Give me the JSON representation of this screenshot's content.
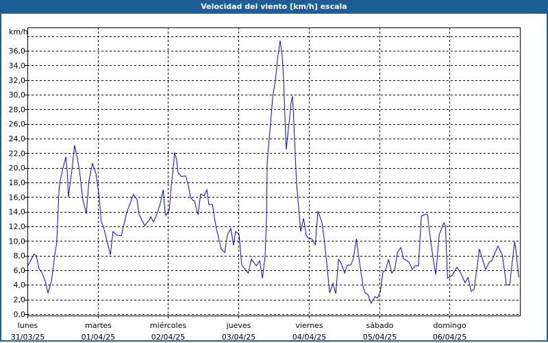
{
  "window": {
    "title": "Velocidad del viento [km/h] escala"
  },
  "chart_data": {
    "type": "line",
    "title": "Velocidad del viento [km/h] escala",
    "ylabel": "km/h",
    "xlabel": "",
    "ylim": [
      -0.2,
      39.2
    ],
    "xlim": [
      0,
      168
    ],
    "grid": true,
    "y_gridlines": [
      0,
      2,
      4,
      6,
      8,
      10,
      12,
      14,
      16,
      18,
      20,
      22,
      24,
      26,
      28,
      30,
      32,
      34,
      36,
      38
    ],
    "y_ticks": [
      "0,0",
      "2,0",
      "4,0",
      "6,0",
      "8,0",
      "10,0",
      "12,0",
      "14,0",
      "16,0",
      "18,0",
      "20,0",
      "22,0",
      "24,0",
      "26,0",
      "28,0",
      "30,0",
      "32,0",
      "34,0",
      "36,0"
    ],
    "x_ticks": [
      {
        "hour": 0,
        "day": "lunes",
        "date": "31/03/25"
      },
      {
        "hour": 24,
        "day": "martes",
        "date": "01/04/25"
      },
      {
        "hour": 48,
        "day": "miércoles",
        "date": "02/04/25"
      },
      {
        "hour": 72,
        "day": "jueves",
        "date": "03/04/25"
      },
      {
        "hour": 96,
        "day": "viernes",
        "date": "04/04/25"
      },
      {
        "hour": 120,
        "day": "sábado",
        "date": "05/04/25"
      },
      {
        "hour": 144,
        "day": "domingo",
        "date": "06/04/25"
      }
    ],
    "series": [
      {
        "name": "Velocidad del viento",
        "color": "#0000ff",
        "points": [
          [
            0,
            6.5
          ],
          [
            2.3,
            8.2
          ],
          [
            3.0,
            8.0
          ],
          [
            4.0,
            6.2
          ],
          [
            4.9,
            5.7
          ],
          [
            6.1,
            4.5
          ],
          [
            7.0,
            2.9
          ],
          [
            8.2,
            4.5
          ],
          [
            9.3,
            8.0
          ],
          [
            10.0,
            9.8
          ],
          [
            10.8,
            17
          ],
          [
            11.2,
            18.3
          ],
          [
            12.4,
            20.4
          ],
          [
            13.1,
            21.5
          ],
          [
            13.6,
            19.5
          ],
          [
            14.0,
            16
          ],
          [
            14.5,
            17.6
          ],
          [
            15.2,
            19.8
          ],
          [
            16.1,
            23.1
          ],
          [
            17.1,
            21.1
          ],
          [
            17.8,
            19.5
          ],
          [
            18.9,
            15.7
          ],
          [
            20.1,
            13.7
          ],
          [
            21.0,
            18.3
          ],
          [
            22.2,
            20.6
          ],
          [
            23.4,
            19.2
          ],
          [
            24.5,
            16
          ],
          [
            25.2,
            12.6
          ],
          [
            25.9,
            12
          ],
          [
            27.1,
            10.1
          ],
          [
            28.3,
            8.1
          ],
          [
            29.2,
            11.3
          ],
          [
            30.4,
            10.8
          ],
          [
            32.0,
            10.7
          ],
          [
            33.9,
            13.9
          ],
          [
            36.2,
            16.4
          ],
          [
            37.4,
            15.6
          ],
          [
            38.1,
            13.6
          ],
          [
            40.0,
            12.1
          ],
          [
            41.6,
            12.9
          ],
          [
            42.1,
            13.3
          ],
          [
            43.0,
            12.6
          ],
          [
            44.4,
            13.9
          ],
          [
            45.3,
            15.1
          ],
          [
            46.3,
            17
          ],
          [
            47.0,
            13.9
          ],
          [
            47.2,
            13.5
          ],
          [
            48.4,
            14.2
          ],
          [
            49.1,
            17.6
          ],
          [
            49.8,
            20.1
          ],
          [
            50.2,
            22.1
          ],
          [
            50.9,
            21.1
          ],
          [
            51.4,
            19.3
          ],
          [
            52.6,
            18.8
          ],
          [
            54.0,
            18.9
          ],
          [
            54.9,
            17.6
          ],
          [
            55.6,
            16
          ],
          [
            56.6,
            15.5
          ],
          [
            57.0,
            15.5
          ],
          [
            57.7,
            14.3
          ],
          [
            58.2,
            13.6
          ],
          [
            59.1,
            16.4
          ],
          [
            60.3,
            16.2
          ],
          [
            61.2,
            17
          ],
          [
            61.9,
            15
          ],
          [
            63.1,
            15
          ],
          [
            64.3,
            12
          ],
          [
            66.1,
            8.9
          ],
          [
            67.3,
            8.4
          ],
          [
            68.2,
            10.8
          ],
          [
            69.4,
            11.7
          ],
          [
            70.3,
            9.4
          ],
          [
            71.0,
            11.3
          ],
          [
            72.2,
            10.9
          ],
          [
            73.1,
            6.7
          ],
          [
            75.3,
            5.6
          ],
          [
            76.4,
            7.5
          ],
          [
            78.1,
            6.6
          ],
          [
            79.2,
            7.3
          ],
          [
            80.2,
            4.9
          ],
          [
            81.1,
            8
          ],
          [
            81.6,
            13.6
          ],
          [
            81.8,
            20.7
          ],
          [
            82.3,
            23.2
          ],
          [
            83.0,
            26.3
          ],
          [
            83.7,
            29.8
          ],
          [
            84.6,
            32
          ],
          [
            85.3,
            34.8
          ],
          [
            86.2,
            37.4
          ],
          [
            86.9,
            35.4
          ],
          [
            87.4,
            32
          ],
          [
            87.9,
            26.3
          ],
          [
            88.3,
            22.5
          ],
          [
            88.8,
            24.5
          ],
          [
            89.3,
            26.3
          ],
          [
            90.0,
            29.1
          ],
          [
            90.4,
            29.8
          ],
          [
            90.7,
            27.9
          ],
          [
            91.4,
            21.4
          ],
          [
            91.8,
            17.9
          ],
          [
            92.8,
            13.2
          ],
          [
            93.2,
            11.3
          ],
          [
            94.2,
            13.1
          ],
          [
            95.1,
            10.8
          ],
          [
            95.8,
            10.4
          ],
          [
            97.0,
            10.3
          ],
          [
            98.2,
            9.5
          ],
          [
            99.1,
            14.1
          ],
          [
            100.5,
            12.5
          ],
          [
            101.2,
            10.4
          ],
          [
            102.1,
            7
          ],
          [
            103.1,
            2.9
          ],
          [
            104.2,
            4.2
          ],
          [
            105.2,
            2.8
          ],
          [
            106.1,
            7.5
          ],
          [
            107.0,
            7
          ],
          [
            108.2,
            5.6
          ],
          [
            109.1,
            6.7
          ],
          [
            110.3,
            6.7
          ],
          [
            111.2,
            7.6
          ],
          [
            112.2,
            10.3
          ],
          [
            112.9,
            8.2
          ],
          [
            114.5,
            3.8
          ],
          [
            115.2,
            2.9
          ],
          [
            116.1,
            2.7
          ],
          [
            117.3,
            1.5
          ],
          [
            118.5,
            2.4
          ],
          [
            119.4,
            2.2
          ],
          [
            120.4,
            3.1
          ],
          [
            121.3,
            5.8
          ],
          [
            122.2,
            6
          ],
          [
            123.2,
            7.5
          ],
          [
            124.3,
            5.6
          ],
          [
            125.3,
            6.1
          ],
          [
            126.2,
            8.4
          ],
          [
            127.4,
            9.1
          ],
          [
            128.3,
            7.6
          ],
          [
            130.2,
            7.1
          ],
          [
            131.3,
            6.1
          ],
          [
            132.3,
            6.6
          ],
          [
            133.4,
            6.6
          ],
          [
            134.4,
            13.4
          ],
          [
            136.0,
            13.7
          ],
          [
            136.5,
            13.6
          ],
          [
            137.2,
            11.1
          ],
          [
            138.4,
            7.6
          ],
          [
            139.3,
            5.4
          ],
          [
            140.5,
            10.9
          ],
          [
            142.1,
            12.5
          ],
          [
            142.6,
            12
          ],
          [
            143.3,
            4.9
          ],
          [
            144.9,
            5.3
          ],
          [
            146.5,
            6.4
          ],
          [
            147.7,
            5.7
          ],
          [
            149.3,
            4.3
          ],
          [
            150.3,
            5
          ],
          [
            151.4,
            3.1
          ],
          [
            152.4,
            3.4
          ],
          [
            154.2,
            8.9
          ],
          [
            156.3,
            6.1
          ],
          [
            157.5,
            7.1
          ],
          [
            158.4,
            7.3
          ],
          [
            160.5,
            9.3
          ],
          [
            162.0,
            8.1
          ],
          [
            163.4,
            4
          ],
          [
            164.5,
            4
          ],
          [
            166.2,
            9.9
          ],
          [
            166.6,
            8.9
          ],
          [
            167.6,
            5
          ]
        ]
      }
    ]
  }
}
